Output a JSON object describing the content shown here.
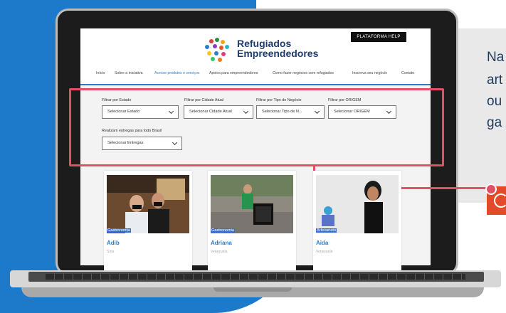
{
  "side_text": {
    "line1": "Na",
    "line2": "art",
    "line3": "ou",
    "line4": "ga"
  },
  "header": {
    "brand_line1": "Refugiados",
    "brand_line2": "Empreendedores",
    "help_button": "PLATAFORMA HELP"
  },
  "nav": {
    "items": [
      "Início",
      "Sobre a iniciativa",
      "Acesse produtos e serviços",
      "Apoios para empreendedores",
      "Como fazer negócios com refugiados",
      "Inscreva seu negócio",
      "Contato"
    ]
  },
  "filters": {
    "estado": {
      "label": "Filtrar por Estado",
      "value": "Selecionar Estado"
    },
    "cidade": {
      "label": "Filtrar por Cidade Atual",
      "value": "Selecionar Cidade Atual"
    },
    "tipo": {
      "label": "Filtrar por Tipo de Negócio",
      "value": "Selecionar Tipo de N..."
    },
    "origem": {
      "label": "Filtrar por ORIGEM",
      "value": "Selecionar ORIGEM"
    },
    "entregas": {
      "label": "Realizam entregas para todo Brasil",
      "value": "Selecionar Entregas"
    }
  },
  "cards": [
    {
      "category": "Gastronomia",
      "name": "Adib",
      "country": "Síria"
    },
    {
      "category": "Gastronomia",
      "name": "Adriana",
      "country": "Venezuela"
    },
    {
      "category": "Artesanato",
      "name": "Aida",
      "country": "Venezuela"
    }
  ],
  "colors": {
    "accent_blue": "#2a7fcf",
    "highlight_red": "#e05167",
    "brand_navy": "#1f3b6e",
    "background_blue": "#1d79c9"
  }
}
